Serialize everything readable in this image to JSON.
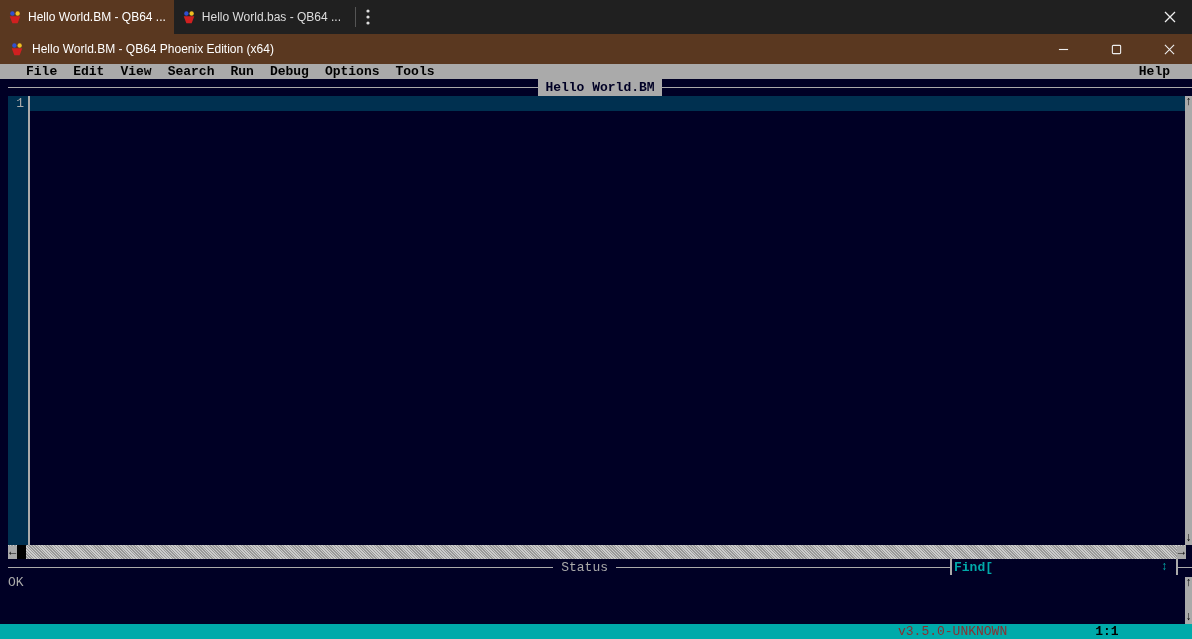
{
  "browser_tabs": [
    {
      "label": "Hello World.BM - QB64 ...",
      "selected": true
    },
    {
      "label": "Hello World.bas - QB64 ...",
      "selected": false
    }
  ],
  "window": {
    "title": "Hello World.BM - QB64 Phoenix Edition (x64)"
  },
  "menu": {
    "items": [
      "File",
      "Edit",
      "View",
      "Search",
      "Run",
      "Debug",
      "Options",
      "Tools"
    ],
    "help": "Help"
  },
  "editor": {
    "title": "Hello World.BM",
    "line_numbers": [
      "1"
    ],
    "scroll_up": "↑",
    "scroll_down": "↓",
    "scroll_left": "←",
    "scroll_right": "→"
  },
  "status": {
    "title": "Status",
    "message": "OK",
    "find_label": "Find[",
    "find_toggle": "↕",
    "scroll_up": "↑",
    "scroll_down": "↓"
  },
  "status_bar": {
    "version": "v3.5.0-UNKNOWN",
    "position": "1:1"
  }
}
